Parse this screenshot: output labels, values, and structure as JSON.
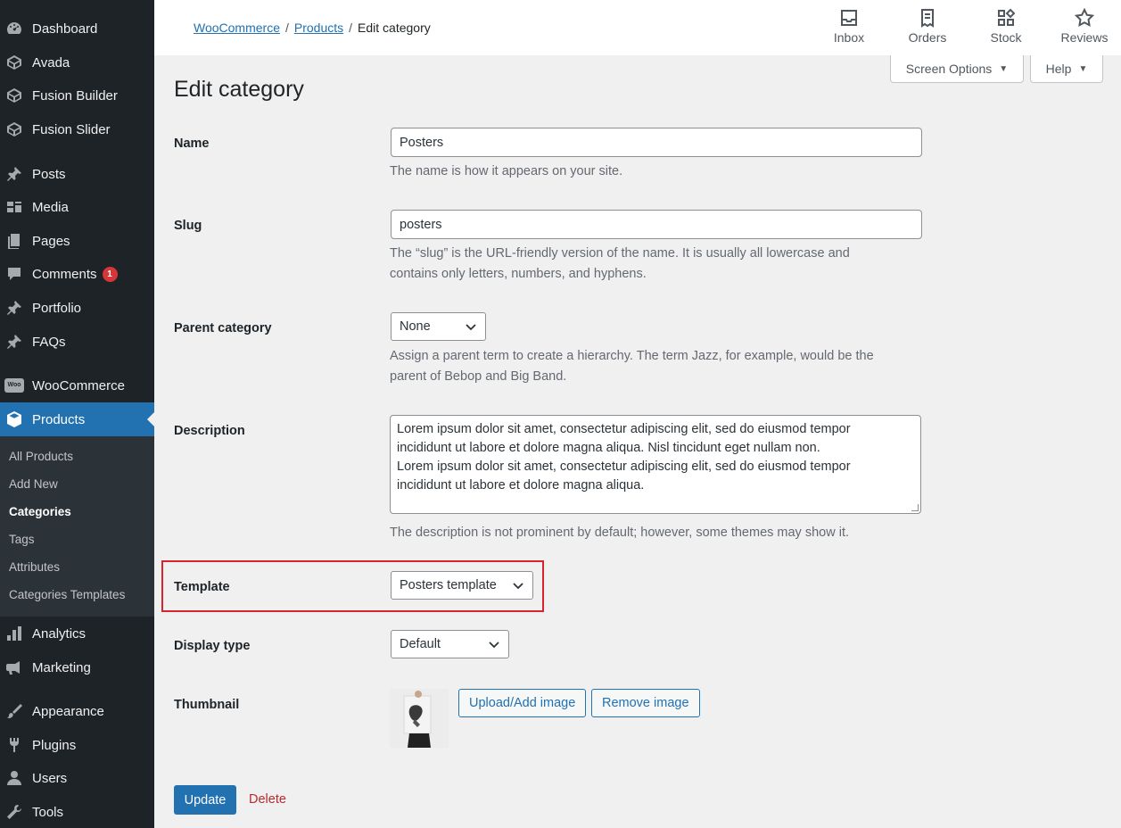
{
  "sidebar": {
    "items": [
      {
        "label": "Dashboard",
        "icon": "dashboard-icon"
      },
      {
        "label": "Avada",
        "icon": "avada-icon"
      },
      {
        "label": "Fusion Builder",
        "icon": "fusion-builder-icon"
      },
      {
        "label": "Fusion Slider",
        "icon": "fusion-slider-icon"
      },
      {
        "label": "Posts",
        "icon": "pin-icon"
      },
      {
        "label": "Media",
        "icon": "media-icon"
      },
      {
        "label": "Pages",
        "icon": "pages-icon"
      },
      {
        "label": "Comments",
        "icon": "comment-icon",
        "badge": "1"
      },
      {
        "label": "Portfolio",
        "icon": "pin-icon"
      },
      {
        "label": "FAQs",
        "icon": "pin-icon"
      },
      {
        "label": "WooCommerce",
        "icon": "woo-icon"
      },
      {
        "label": "Products",
        "icon": "products-icon"
      },
      {
        "label": "Analytics",
        "icon": "analytics-icon"
      },
      {
        "label": "Marketing",
        "icon": "megaphone-icon"
      },
      {
        "label": "Appearance",
        "icon": "brush-icon"
      },
      {
        "label": "Plugins",
        "icon": "plugin-icon"
      },
      {
        "label": "Users",
        "icon": "users-icon"
      },
      {
        "label": "Tools",
        "icon": "wrench-icon"
      }
    ],
    "submenu": [
      "All Products",
      "Add New",
      "Categories",
      "Tags",
      "Attributes",
      "Categories Templates"
    ],
    "woo_logo_text": "Woo"
  },
  "topbar": {
    "breadcrumb": [
      "WooCommerce",
      "Products",
      "Edit category"
    ],
    "actions": [
      "Inbox",
      "Orders",
      "Stock",
      "Reviews"
    ]
  },
  "screen_options": "Screen Options",
  "help": "Help",
  "page_title": "Edit category",
  "form": {
    "name_label": "Name",
    "name_value": "Posters",
    "name_help": "The name is how it appears on your site.",
    "slug_label": "Slug",
    "slug_value": "posters",
    "slug_help_1": "The “slug” is the URL-friendly version of the name. It is usually all lowercase and",
    "slug_help_2": "contains only letters, numbers, and hyphens.",
    "parent_label": "Parent category",
    "parent_value": "None",
    "parent_help_1": "Assign a parent term to create a hierarchy. The term Jazz, for example, would be the",
    "parent_help_2": "parent of Bebop and Big Band.",
    "description_label": "Description",
    "description_lines": [
      "Lorem ipsum dolor sit amet, consectetur adipiscing elit, sed do eiusmod tempor",
      "incididunt ut labore et dolore magna aliqua. Nisl tincidunt eget nullam non.",
      "Lorem ipsum dolor sit amet, consectetur adipiscing elit, sed do eiusmod tempor",
      "incididunt ut labore et dolore magna aliqua."
    ],
    "description_help": "The description is not prominent by default; however, some themes may show it.",
    "template_label": "Template",
    "template_value": "Posters template",
    "display_type_label": "Display type",
    "display_type_value": "Default",
    "thumbnail_label": "Thumbnail",
    "upload_button": "Upload/Add image",
    "remove_button": "Remove image",
    "update_button": "Update",
    "delete_link": "Delete"
  },
  "colors": {
    "sidebar_bg": "#1d2327",
    "accent": "#2271b1",
    "highlight": "#d9232e",
    "delete": "#b32d2e"
  }
}
